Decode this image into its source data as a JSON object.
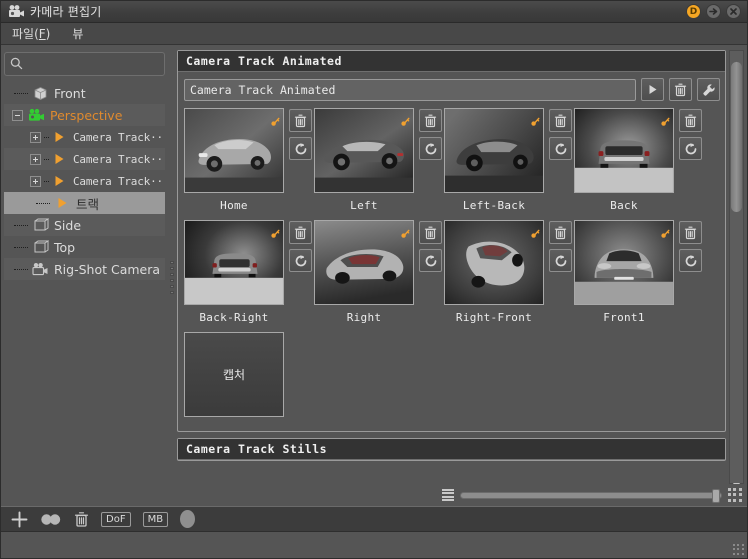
{
  "window": {
    "title": "카메라 편집기",
    "icon": "video-camera-icon",
    "buttons": [
      {
        "name": "dock-button",
        "label": "D"
      },
      {
        "name": "detach-button",
        "label": "→"
      },
      {
        "name": "close-button",
        "label": "✕"
      }
    ]
  },
  "menubar": {
    "items": [
      {
        "name": "menu-file",
        "label": "파일(F)",
        "base": "파일(",
        "accel": "F",
        "tail": ")"
      },
      {
        "name": "menu-view",
        "label": "뷰"
      }
    ]
  },
  "sidebar": {
    "search": {
      "placeholder": "",
      "value": "",
      "icon": "search-icon"
    },
    "tree": [
      {
        "label": "Front",
        "icon": "cube-icon",
        "depth": 0,
        "expander": "none",
        "state": "normal"
      },
      {
        "label": "Perspective",
        "icon": "camera-green-icon",
        "depth": 0,
        "expander": "minus",
        "state": "active"
      },
      {
        "label": "Camera Track··",
        "icon": "play-triangle-icon",
        "depth": 1,
        "expander": "plus",
        "state": "normal"
      },
      {
        "label": "Camera Track··",
        "icon": "play-triangle-icon",
        "depth": 1,
        "expander": "plus",
        "state": "normal"
      },
      {
        "label": "Camera Track··",
        "icon": "play-triangle-icon",
        "depth": 1,
        "expander": "plus",
        "state": "normal"
      },
      {
        "label": "트랙",
        "icon": "play-triangle-icon",
        "depth": 1,
        "expander": "none",
        "state": "selected"
      },
      {
        "label": "Side",
        "icon": "cube-icon",
        "depth": 0,
        "expander": "none",
        "state": "normal"
      },
      {
        "label": "Top",
        "icon": "cube-icon",
        "depth": 0,
        "expander": "none",
        "state": "normal"
      },
      {
        "label": "Rig-Shot Camera",
        "icon": "camera-icon",
        "depth": 0,
        "expander": "none",
        "state": "normal"
      }
    ]
  },
  "main": {
    "groups": [
      {
        "name": "camera-track-animated",
        "title": "Camera Track Animated",
        "toolbar": {
          "name_value": "Camera Track Animated",
          "name_placeholder": "",
          "play_label": "play-icon",
          "delete_label": "trash-icon",
          "settings_label": "wrench-icon"
        },
        "shots": [
          {
            "label": "Home",
            "view": "front-three-quarter"
          },
          {
            "label": "Left",
            "view": "left-side"
          },
          {
            "label": "Left-Back",
            "view": "left-rear-three-quarter"
          },
          {
            "label": "Back",
            "view": "rear"
          },
          {
            "label": "Back-Right",
            "view": "rear-dark"
          },
          {
            "label": "Right",
            "view": "right-top"
          },
          {
            "label": "Right-Front",
            "view": "right-front-three-quarter"
          },
          {
            "label": "Front1",
            "view": "front"
          }
        ],
        "capture_button": {
          "label": "캡처"
        }
      },
      {
        "name": "camera-track-stills",
        "title": "Camera Track Stills"
      }
    ],
    "shot_buttons": {
      "delete": "trash-icon",
      "refresh": "refresh-icon"
    },
    "zoom_slider": {
      "value": 100,
      "min": 0,
      "max": 100
    },
    "list_icon": "list-view-icon",
    "grid_icon": "grid-view-icon"
  },
  "bottom_toolbar": {
    "items": [
      {
        "name": "add-camera-button",
        "icon": "plus-icon",
        "label": ""
      },
      {
        "name": "stereo-button",
        "icon": "two-circles-icon",
        "label": ""
      },
      {
        "name": "delete-camera-button",
        "icon": "trash-icon",
        "label": ""
      },
      {
        "name": "dof-button",
        "icon": "text-button",
        "label": "DoF"
      },
      {
        "name": "motion-blur-button",
        "icon": "text-button",
        "label": "MB"
      },
      {
        "name": "aperture-button",
        "icon": "oval-icon",
        "label": ""
      }
    ]
  },
  "colors": {
    "accent_orange": "#e08a2e",
    "camera_green": "#33cc33",
    "window_bg": "#555555",
    "panel_header": "#333333",
    "selection": "#9a9a9a",
    "title_bar": "#3e3e3e"
  }
}
